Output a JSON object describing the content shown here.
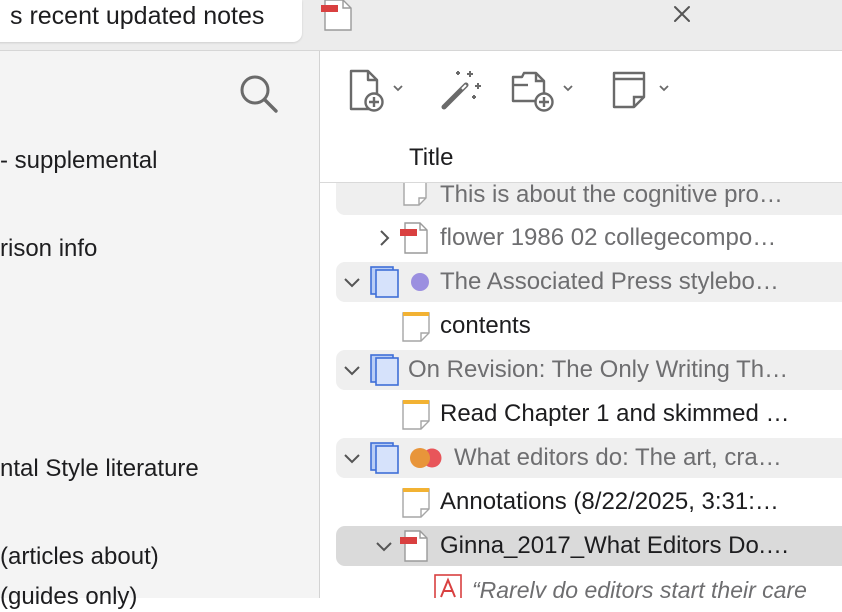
{
  "tab": {
    "active_label": "s recent updated notes"
  },
  "left_pane": {
    "items": [
      "- supplemental",
      "rison info",
      "ntal Style literature",
      "(articles about)",
      "(guides only)"
    ]
  },
  "list": {
    "column_title": "Title",
    "rows": [
      {
        "text": "This is about the cognitive pro…"
      },
      {
        "text": "flower 1986 02 collegecompo…"
      },
      {
        "text": "The Associated Press stylebo…"
      },
      {
        "text": "contents"
      },
      {
        "text": "On Revision: The Only Writing Th…"
      },
      {
        "text": "Read Chapter 1 and skimmed …"
      },
      {
        "text": "What editors do: The art, cra…"
      },
      {
        "text": "Annotations (8/22/2025, 3:31:…"
      },
      {
        "text": "Ginna_2017_What Editors Do.…"
      },
      {
        "text": "“Rarely do editors start their care"
      }
    ]
  },
  "colors": {
    "tag_purple": "#9b8fe0",
    "tag_orange": "#e8953a",
    "tag_red": "#e8555a",
    "book_blue": "#3f6fd8",
    "note_yellow": "#f2b233",
    "pdf_red": "#d94040"
  },
  "icons": {
    "tab": "pdf-document-icon",
    "close": "close-icon",
    "search": "search-icon",
    "new_item": "new-item-icon",
    "magic": "magic-wand-icon",
    "attach": "add-attachment-icon",
    "note": "new-note-icon"
  }
}
